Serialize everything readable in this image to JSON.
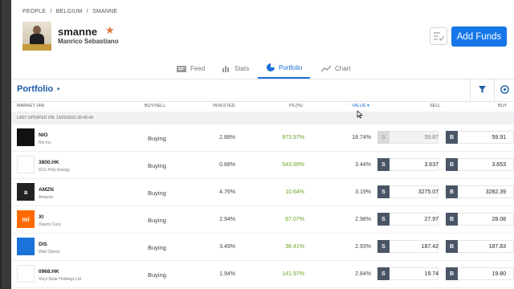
{
  "breadcrumb": [
    "PEOPLE",
    "/",
    "BELGIUM",
    "/",
    "SMANNE"
  ],
  "profile": {
    "username": "smanne",
    "fullname": "Manrico Sebastiano",
    "star_icon": "star-icon"
  },
  "header": {
    "add_funds_label": "Add Funds"
  },
  "tabs": [
    {
      "label": "Feed",
      "icon": "feed-icon"
    },
    {
      "label": "Stats",
      "icon": "stats-icon"
    },
    {
      "label": "Portfolio",
      "icon": "pie-icon"
    },
    {
      "label": "Chart",
      "icon": "chart-icon"
    }
  ],
  "toolbar": {
    "title": "Portfolio",
    "caret": "▾"
  },
  "columns": {
    "market": "MARKET (44)",
    "buysell": "BUY/SELL",
    "invested": "INVESTED",
    "pl": "P/L(%)",
    "value": "VALUE",
    "sell": "SELL",
    "buy": "BUY"
  },
  "last_updated": "LAST UPDATED ON: 13/02/2021 06:42:44",
  "rows": [
    {
      "ticker": "NIO",
      "name": "Nio Inc.",
      "action": "Buying",
      "invested": "2.88%",
      "pl": "973.97%",
      "value": "18.74%",
      "sell": "59.87",
      "buy": "59.91",
      "logo_text": "",
      "logo_color": "#111111"
    },
    {
      "ticker": "3800.HK",
      "name": "GCL-Poly Energy",
      "action": "Buying",
      "invested": "0.88%",
      "pl": "543.99%",
      "value": "3.44%",
      "sell": "3.637",
      "buy": "3.653",
      "logo_text": "",
      "logo_color": "#ffffff"
    },
    {
      "ticker": "AMZN",
      "name": "Amazon",
      "action": "Buying",
      "invested": "4.76%",
      "pl": "10.64%",
      "value": "3.19%",
      "sell": "3275.07",
      "buy": "3282.39",
      "logo_text": "a",
      "logo_color": "#222222"
    },
    {
      "ticker": "XI",
      "name": "Xiaomi Corp",
      "action": "Buying",
      "invested": "2.94%",
      "pl": "67.07%",
      "value": "2.98%",
      "sell": "27.97",
      "buy": "28.08",
      "logo_text": "mi",
      "logo_color": "#ff6a00"
    },
    {
      "ticker": "DIS",
      "name": "Walt Disney",
      "action": "Buying",
      "invested": "3.49%",
      "pl": "38.41%",
      "value": "2.93%",
      "sell": "187.42",
      "buy": "187.83",
      "logo_text": "",
      "logo_color": "#1a73d9"
    },
    {
      "ticker": "0968.HK",
      "name": "Xinyi Solar Holdings Ltd",
      "action": "Buying",
      "invested": "1.94%",
      "pl": "141.97%",
      "value": "2.84%",
      "sell": "19.74",
      "buy": "19.80",
      "logo_text": "",
      "logo_color": "#ffffff"
    }
  ],
  "buttons": {
    "sell": "S",
    "buy": "B"
  }
}
